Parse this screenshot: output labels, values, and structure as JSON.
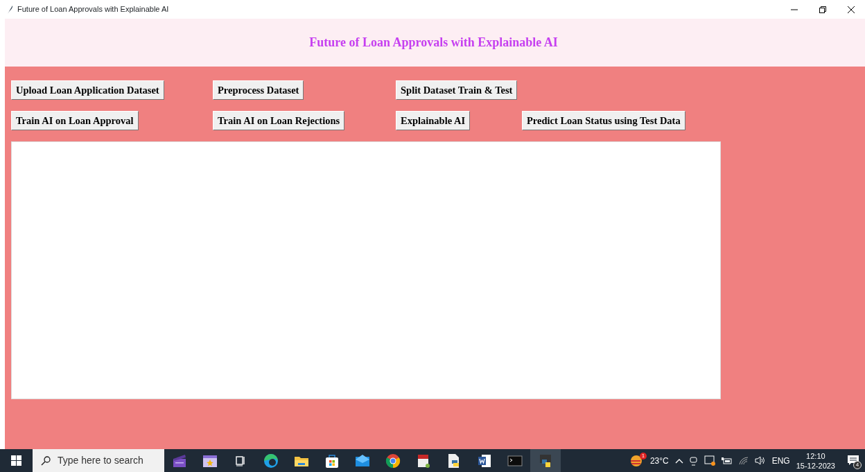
{
  "window": {
    "title": "Future of Loan Approvals with Explainable AI"
  },
  "header": {
    "title": "Future of Loan Approvals with Explainable AI"
  },
  "buttons": [
    {
      "label": "Upload Loan Application Dataset"
    },
    {
      "label": "Preprocess Dataset"
    },
    {
      "label": "Split Dataset Train & Test"
    },
    {
      "label": "Train AI on Loan Approval"
    },
    {
      "label": "Train AI on Loan Rejections"
    },
    {
      "label": "Explainable AI"
    },
    {
      "label": "Predict Loan Status using Test Data"
    }
  ],
  "taskbar": {
    "search": {
      "placeholder": "Type here to search"
    },
    "apps": [
      {
        "kind": "clapper",
        "selected": false
      },
      {
        "kind": "notes",
        "selected": false
      },
      {
        "kind": "taskview",
        "selected": false
      },
      {
        "kind": "edge",
        "selected": false
      },
      {
        "kind": "folder",
        "selected": false
      },
      {
        "kind": "store",
        "selected": false
      },
      {
        "kind": "mail",
        "selected": false
      },
      {
        "kind": "chrome",
        "selected": false
      },
      {
        "kind": "calendar",
        "selected": false
      },
      {
        "kind": "pyfile",
        "selected": false
      },
      {
        "kind": "word",
        "selected": false
      },
      {
        "kind": "terminal",
        "selected": false
      },
      {
        "kind": "python",
        "selected": true
      }
    ],
    "weather": {
      "badge": "1",
      "temperature": "23°C"
    },
    "language": "ENG",
    "time": "12:10",
    "date": "15-12-2023",
    "notifications": "4"
  }
}
